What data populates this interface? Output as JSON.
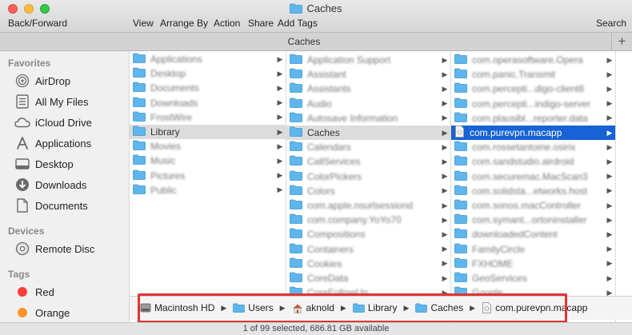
{
  "window": {
    "title": "Caches"
  },
  "toolbar": {
    "back_forward": "Back/Forward",
    "view": "View",
    "arrange_by": "Arrange By",
    "action": "Action",
    "share": "Share",
    "add_tags": "Add Tags",
    "search": "Search"
  },
  "tab": {
    "label": "Caches",
    "plus": "+"
  },
  "sidebar": {
    "favorites_header": "Favorites",
    "favorites": [
      {
        "label": "AirDrop",
        "icon": "airdrop-icon"
      },
      {
        "label": "All My Files",
        "icon": "all-files-icon"
      },
      {
        "label": "iCloud Drive",
        "icon": "cloud-icon"
      },
      {
        "label": "Applications",
        "icon": "applications-icon"
      },
      {
        "label": "Desktop",
        "icon": "desktop-icon"
      },
      {
        "label": "Downloads",
        "icon": "downloads-icon"
      },
      {
        "label": "Documents",
        "icon": "documents-icon"
      }
    ],
    "devices_header": "Devices",
    "devices": [
      {
        "label": "Remote Disc",
        "icon": "disc-icon"
      }
    ],
    "tags_header": "Tags",
    "tags": [
      {
        "label": "Red",
        "color": "#fc3d39"
      },
      {
        "label": "Orange",
        "color": "#fd9426"
      }
    ]
  },
  "columns": {
    "col1": [
      {
        "name": "Applications",
        "blurred": true
      },
      {
        "name": "Desktop",
        "blurred": true
      },
      {
        "name": "Documents",
        "blurred": true
      },
      {
        "name": "Downloads",
        "blurred": true
      },
      {
        "name": "FrostWire",
        "blurred": true
      },
      {
        "name": "Library",
        "blurred": false,
        "selected": "gray"
      },
      {
        "name": "Movies",
        "blurred": true
      },
      {
        "name": "Music",
        "blurred": true
      },
      {
        "name": "Pictures",
        "blurred": true
      },
      {
        "name": "Public",
        "blurred": true
      }
    ],
    "col2": [
      {
        "name": "Application Support",
        "blurred": true
      },
      {
        "name": "Assistant",
        "blurred": true
      },
      {
        "name": "Assistants",
        "blurred": true
      },
      {
        "name": "Audio",
        "blurred": true
      },
      {
        "name": "Autosave Information",
        "blurred": true
      },
      {
        "name": "Caches",
        "blurred": false,
        "selected": "gray"
      },
      {
        "name": "Calendars",
        "blurred": true
      },
      {
        "name": "CallServices",
        "blurred": true
      },
      {
        "name": "ColorPickers",
        "blurred": true
      },
      {
        "name": "Colors",
        "blurred": true
      },
      {
        "name": "com.apple.nsurlsessiond",
        "blurred": true
      },
      {
        "name": "com.company.YoYo70",
        "blurred": true
      },
      {
        "name": "Compositions",
        "blurred": true
      },
      {
        "name": "Containers",
        "blurred": true
      },
      {
        "name": "Cookies",
        "blurred": true
      },
      {
        "name": "CoreData",
        "blurred": true
      },
      {
        "name": "CoreFollowUp",
        "blurred": true
      }
    ],
    "col3": [
      {
        "name": "com.operasoftware.Opera",
        "blurred": true
      },
      {
        "name": "com.panic.Transmit",
        "blurred": true
      },
      {
        "name": "com.percepti...digo-client8",
        "blurred": true
      },
      {
        "name": "com.percepti...indigo-server",
        "blurred": true
      },
      {
        "name": "com.plausibl...reporter.data",
        "blurred": true
      },
      {
        "name": "com.purevpn.macapp",
        "blurred": false,
        "selected": "blue",
        "file": true
      },
      {
        "name": "com.rossetantoine.osirix",
        "blurred": true
      },
      {
        "name": "com.sandstudio.airdroid",
        "blurred": true
      },
      {
        "name": "com.securemac.MacScan3",
        "blurred": true
      },
      {
        "name": "com.solidsta...etworks.host",
        "blurred": true
      },
      {
        "name": "com.sonos.macController",
        "blurred": true
      },
      {
        "name": "com.symant...ortoninstaller",
        "blurred": true
      },
      {
        "name": "downloadedContent",
        "blurred": true
      },
      {
        "name": "FamilyCircle",
        "blurred": true
      },
      {
        "name": "FXHOME",
        "blurred": true
      },
      {
        "name": "GeoServices",
        "blurred": true
      },
      {
        "name": "Google",
        "blurred": true
      }
    ]
  },
  "pathbar": {
    "crumbs": [
      {
        "label": "Macintosh HD",
        "icon": "hard-drive-icon"
      },
      {
        "label": "Users",
        "icon": "folder-icon"
      },
      {
        "label": "aknold",
        "icon": "home-icon"
      },
      {
        "label": "Library",
        "icon": "folder-icon"
      },
      {
        "label": "Caches",
        "icon": "folder-icon"
      },
      {
        "label": "com.purevpn.macapp",
        "icon": "file-icon"
      }
    ]
  },
  "status": {
    "text": "1 of 99 selected, 686.81 GB available"
  },
  "colors": {
    "selection_blue": "#1662d6",
    "folder_blue": "#5fb6ec",
    "highlight_red": "#e13434"
  }
}
